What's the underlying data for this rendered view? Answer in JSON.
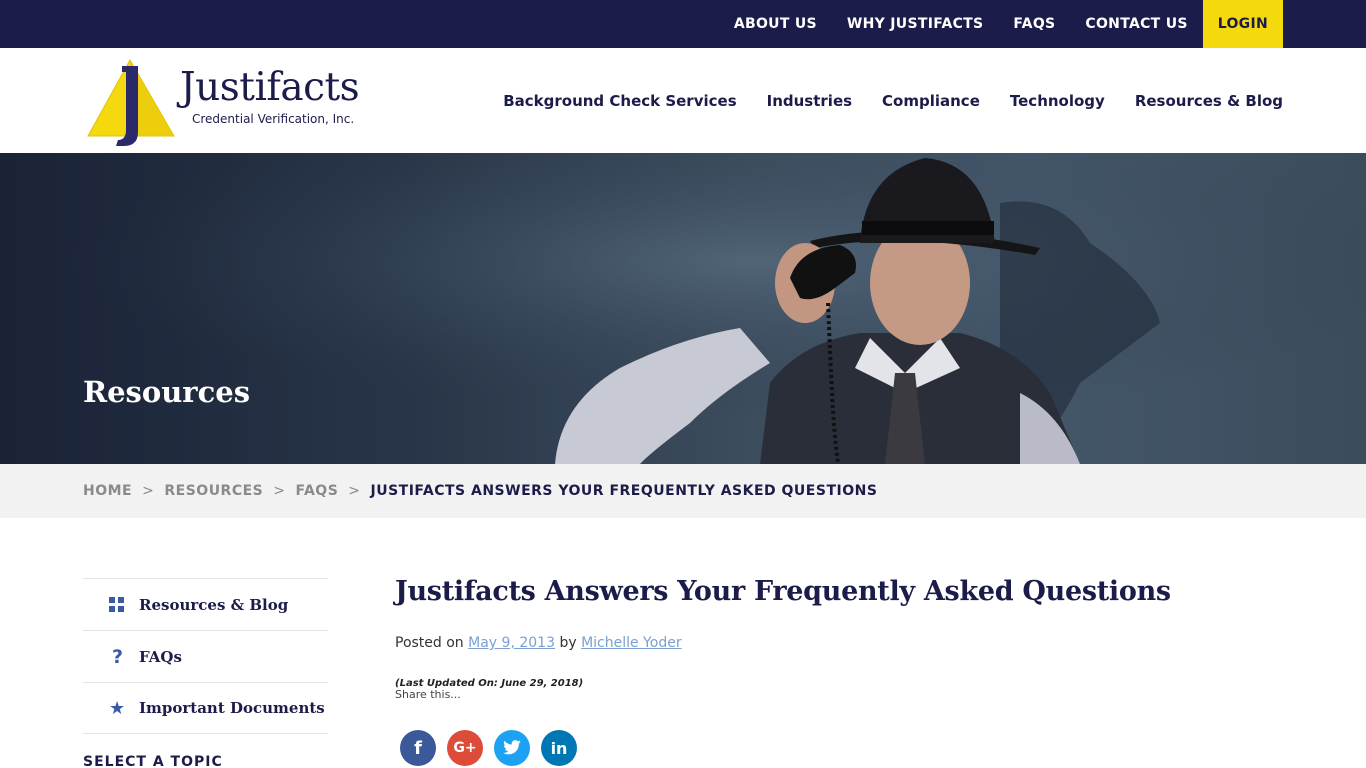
{
  "topnav": {
    "items": [
      "ABOUT US",
      "WHY JUSTIFACTS",
      "FAQS",
      "CONTACT US"
    ],
    "login": "LOGIN"
  },
  "logo": {
    "name": "Justifacts",
    "tagline": "Credential Verification, Inc."
  },
  "mainnav": {
    "items": [
      "Background Check Services",
      "Industries",
      "Compliance",
      "Technology",
      "Resources & Blog"
    ]
  },
  "hero": {
    "title": "Resources"
  },
  "breadcrumb": {
    "items": [
      "HOME",
      "RESOURCES",
      "FAQS"
    ],
    "current": "JUSTIFACTS ANSWERS YOUR FREQUENTLY ASKED QUESTIONS",
    "separator": ">"
  },
  "sidebar": {
    "items": [
      {
        "label": "Resources & Blog",
        "icon": "grid-icon"
      },
      {
        "label": "FAQs",
        "icon": "question-icon"
      },
      {
        "label": "Important Documents",
        "icon": "star-icon"
      }
    ],
    "topic_heading": "SELECT A TOPIC"
  },
  "article": {
    "title": "Justifacts Answers Your Frequently Asked Questions",
    "posted_prefix": "Posted on",
    "date": "May 9, 2013",
    "by": "by",
    "author": "Michelle Yoder",
    "updated": "(Last Updated On: June 29, 2018)",
    "share_label": "Share this..."
  },
  "social": [
    {
      "name": "facebook",
      "glyph": "f",
      "color": "#3b5998"
    },
    {
      "name": "google-plus",
      "glyph": "G+",
      "color": "#dd4b39"
    },
    {
      "name": "twitter",
      "glyph": "t",
      "color": "#1da1f2"
    },
    {
      "name": "linkedin",
      "glyph": "in",
      "color": "#0077b5"
    }
  ],
  "colors": {
    "navy": "#1c1c4a",
    "login_yellow": "#f5d90f",
    "link_blue": "#7b9fd0"
  }
}
